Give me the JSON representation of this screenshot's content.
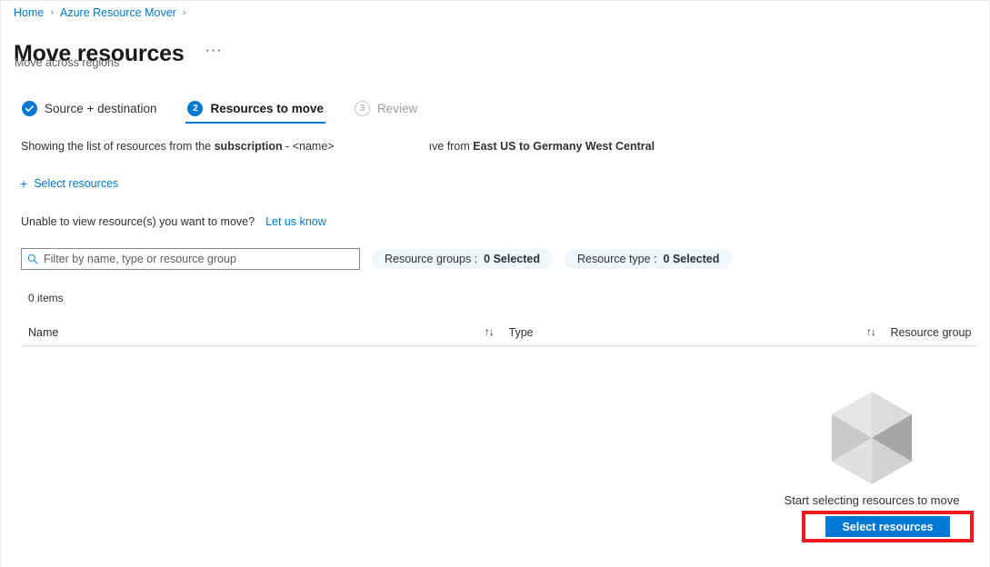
{
  "breadcrumb": {
    "items": [
      {
        "label": "Home"
      },
      {
        "label": "Azure Resource Mover"
      }
    ],
    "separator": "›"
  },
  "header": {
    "title": "Move resources",
    "more_label": "···",
    "subtitle": "Move across regions"
  },
  "wizard": {
    "steps": [
      {
        "badge": "✓",
        "label": "Source + destination",
        "state": "done"
      },
      {
        "badge": "2",
        "label": "Resources to move",
        "state": "active"
      },
      {
        "badge": "3",
        "label": "Review",
        "state": "disabled"
      }
    ]
  },
  "info": {
    "prefix": "Showing the list of resources from the ",
    "bold_subscription": "subscription",
    "middle": " - <name>",
    "suffix_lead": "ıve from ",
    "bold_regions": "East US to Germany West Central"
  },
  "commands": {
    "select_resources_plus": "+",
    "select_resources": "Select resources"
  },
  "help": {
    "question": "Unable to view resource(s) you want to move?",
    "link": "Let us know"
  },
  "filters": {
    "search_placeholder": "Filter by name, type or resource group",
    "search_value": "",
    "pills": [
      {
        "key": "Resource groups :",
        "value": "0 Selected"
      },
      {
        "key": "Resource type :",
        "value": "0 Selected"
      }
    ]
  },
  "grid": {
    "item_count": "0 items",
    "sort_glyph": "↑↓",
    "columns": [
      {
        "header": "Name"
      },
      {
        "header": "Type"
      },
      {
        "header": "Resource group"
      }
    ],
    "rows": []
  },
  "empty_state": {
    "message": "Start selecting resources to move",
    "button_label": "Select resources"
  },
  "colors": {
    "accent": "#0078d4",
    "link": "#0078d4",
    "pill_bg": "#eff6fc",
    "highlight": "#ec1c24",
    "text": "#323130",
    "muted": "#605e5c",
    "disabled": "#a19f9d"
  }
}
